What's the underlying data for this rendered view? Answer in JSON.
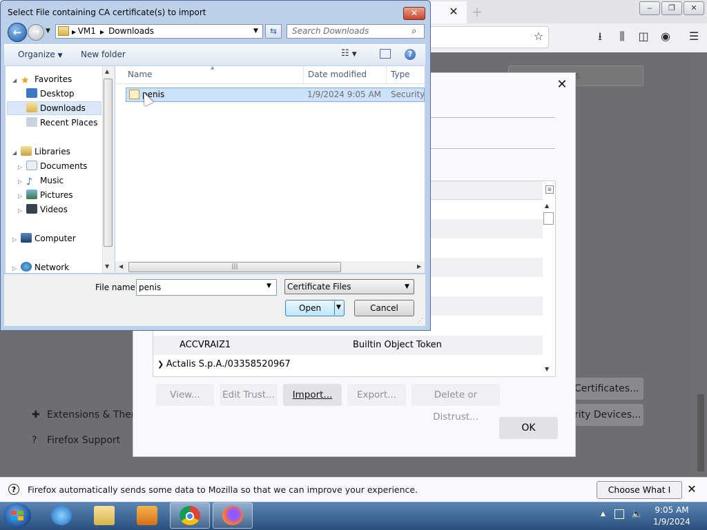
{
  "firefox": {
    "tab_close": "✕",
    "new_tab": "+",
    "window": {
      "min": "‒",
      "max": "❐",
      "close": "✕"
    },
    "search_prefs_placeholder": "ons",
    "sidebar": [
      {
        "label": "Extensions & Themes",
        "icon": "puzzle-icon"
      },
      {
        "label": "Firefox Support",
        "icon": "help-icon"
      }
    ],
    "bg_buttons": {
      "certificates": "Certificates...",
      "security_devices": "rity Devices..."
    },
    "notification": {
      "text": "Firefox automatically sends some data to Mozilla so that we can improve your experience.",
      "button": "Choose What I Share",
      "close": "✕"
    }
  },
  "cert_manager": {
    "close": "✕",
    "rows": [
      {
        "name": "ACCVRAIZ1",
        "token": "Builtin Object Token"
      }
    ],
    "group": "Actalis S.p.A./03358520967",
    "buttons": {
      "view": "View...",
      "edit_trust": "Edit Trust...",
      "import": "Import...",
      "export": "Export...",
      "delete": "Delete or Distrust...",
      "ok": "OK"
    }
  },
  "file_dialog": {
    "title": "Select File containing CA certificate(s) to import",
    "close": "✕",
    "breadcrumb": [
      "VM1",
      "Downloads"
    ],
    "search_placeholder": "Search Downloads",
    "toolbar": {
      "organize": "Organize",
      "new_folder": "New folder"
    },
    "nav": {
      "favorites": "Favorites",
      "desktop": "Desktop",
      "downloads": "Downloads",
      "recent": "Recent Places",
      "libraries": "Libraries",
      "documents": "Documents",
      "music": "Music",
      "pictures": "Pictures",
      "videos": "Videos",
      "computer": "Computer",
      "network": "Network"
    },
    "columns": {
      "name": "Name",
      "date": "Date modified",
      "type": "Type"
    },
    "files": [
      {
        "name": "penis",
        "date": "1/9/2024 9:05 AM",
        "type": "Security Certificate"
      }
    ],
    "file_name_label": "File name:",
    "file_name_value": "penis",
    "filter": "Certificate Files",
    "open": "Open",
    "cancel": "Cancel"
  },
  "taskbar": {
    "time": "9:05 AM",
    "date": "1/9/2024"
  }
}
